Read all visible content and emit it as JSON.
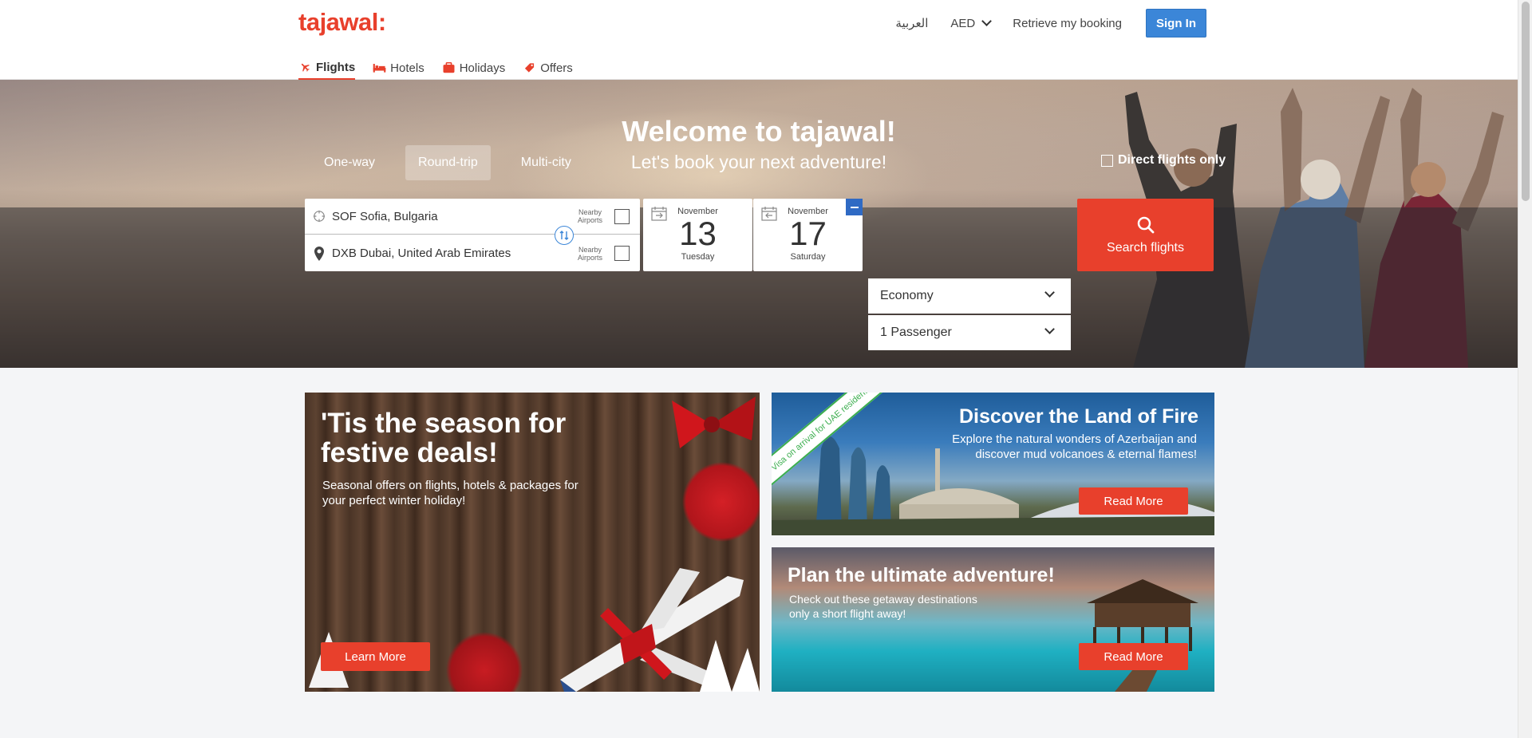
{
  "header": {
    "logo": "tajawal:",
    "language": "العربية",
    "currency": "AED",
    "retrieve_booking": "Retrieve my booking",
    "sign_in": "Sign In",
    "nav": [
      {
        "label": "Flights",
        "icon": "plane-icon",
        "active": true
      },
      {
        "label": "Hotels",
        "icon": "bed-icon"
      },
      {
        "label": "Holidays",
        "icon": "suitcase-icon"
      },
      {
        "label": "Offers",
        "icon": "tag-icon"
      }
    ]
  },
  "hero": {
    "title": "Welcome to tajawal!",
    "subtitle": "Let's book your next adventure!"
  },
  "search": {
    "trip_types": [
      "One-way",
      "Round-trip",
      "Multi-city"
    ],
    "active_trip_type": "Round-trip",
    "direct_only_label": "Direct flights only",
    "origin": "SOF Sofia, Bulgaria",
    "destination": "DXB Dubai, United Arab Emirates",
    "nearby_label_1": "Nearby",
    "nearby_label_2": "Airports",
    "depart": {
      "month": "November",
      "day": "13",
      "weekday": "Tuesday"
    },
    "return": {
      "month": "November",
      "day": "17",
      "weekday": "Saturday"
    },
    "cabin": "Economy",
    "passengers": "1 Passenger",
    "search_button": "Search flights"
  },
  "promos": {
    "festive": {
      "title": "'Tis the season for festive deals!",
      "subtitle": "Seasonal offers on flights, hotels & packages for your perfect winter holiday!",
      "button": "Learn More"
    },
    "fire": {
      "ribbon": "Visa on arrival for UAE residents",
      "title": "Discover the Land of Fire",
      "subtitle": "Explore the natural wonders of Azerbaijan and discover mud volcanoes & eternal flames!",
      "button": "Read More"
    },
    "adventure": {
      "title": "Plan the ultimate adventure!",
      "subtitle": "Check out these getaway destinations only a short flight away!",
      "button": "Read More"
    }
  },
  "colors": {
    "brand": "#e8402c",
    "sign_in": "#3b86d8"
  }
}
